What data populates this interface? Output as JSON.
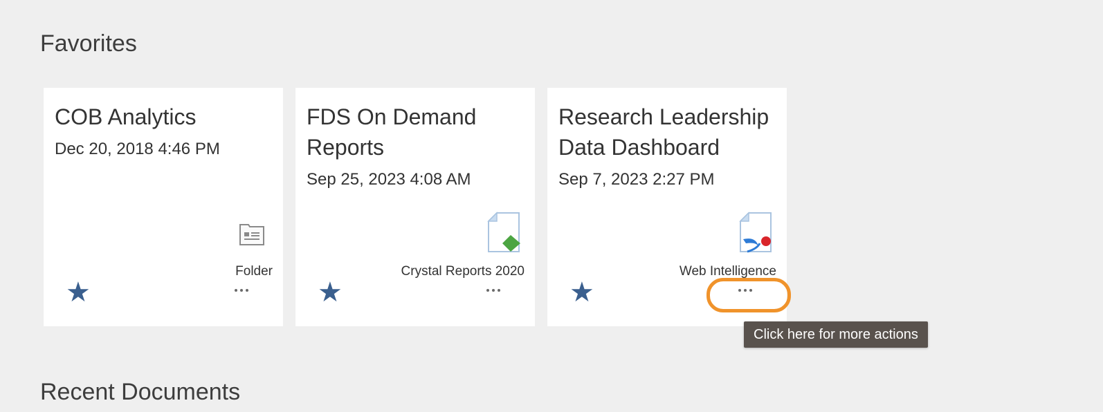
{
  "sections": {
    "favorites_title": "Favorites",
    "recent_title": "Recent Documents"
  },
  "tiles": [
    {
      "title": "COB Analytics",
      "date": "Dec 20, 2018 4:46 PM",
      "type_label": "Folder",
      "type_icon": "folder-icon"
    },
    {
      "title": "FDS On Demand Reports",
      "date": "Sep 25, 2023 4:08 AM",
      "type_label": "Crystal Reports 2020",
      "type_icon": "crystal-reports-icon"
    },
    {
      "title": "Research Leadership Data Dashboard",
      "date": "Sep 7, 2023 2:27 PM",
      "type_label": "Web Intelligence",
      "type_icon": "web-intelligence-icon"
    }
  ],
  "tooltip": {
    "text": "Click here for more actions"
  },
  "colors": {
    "star": "#3a5f8e",
    "highlight": "#f0932b",
    "tooltip_bg": "#59524d"
  }
}
